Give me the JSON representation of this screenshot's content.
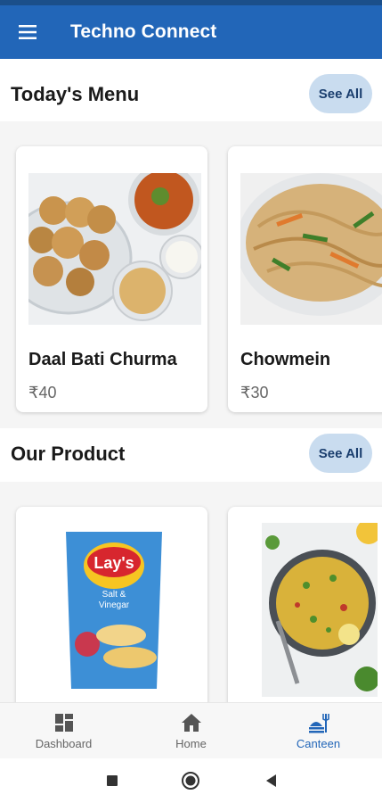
{
  "app": {
    "title": "Techno Connect"
  },
  "menu_section": {
    "title": "Today's Menu",
    "see_all": "See All",
    "items": [
      {
        "name": "Daal Bati Churma",
        "price": "₹40"
      },
      {
        "name": "Chowmein",
        "price": "₹30"
      }
    ]
  },
  "product_section": {
    "title": "Our Product",
    "see_all": "See All",
    "items": [
      {
        "brand": "Lay's",
        "flavor_line1": "Salt &",
        "flavor_line2": "Vinegar"
      },
      {
        "name": ""
      }
    ]
  },
  "bottom_nav": {
    "items": [
      {
        "label": "Dashboard",
        "icon": "dashboard-icon",
        "active": false
      },
      {
        "label": "Home",
        "icon": "home-icon",
        "active": false
      },
      {
        "label": "Canteen",
        "icon": "canteen-icon",
        "active": true
      }
    ]
  },
  "colors": {
    "primary": "#2266b8",
    "see_all_bg": "#c9dcef",
    "active_nav": "#2266b8"
  }
}
